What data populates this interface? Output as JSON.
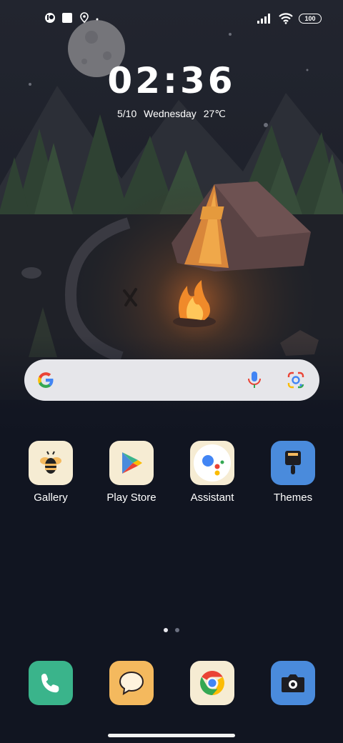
{
  "status_bar": {
    "left_icons": [
      "app-notification-icon",
      "square-notification-icon",
      "location-pin-icon",
      "more-dot-icon"
    ],
    "right_icons": [
      "signal-icon",
      "wifi-icon"
    ],
    "battery": "100"
  },
  "clock": {
    "time": "02:36",
    "date": "5/10",
    "weekday": "Wednesday",
    "temperature": "27℃"
  },
  "search": {
    "icons": [
      "google-logo-icon",
      "microphone-icon",
      "google-lens-icon"
    ]
  },
  "apps": [
    {
      "label": "Gallery",
      "icon": "bee-icon",
      "bg": "#f6ecd3"
    },
    {
      "label": "Play Store",
      "icon": "play-triangle-icon",
      "bg": "#f6ecd3"
    },
    {
      "label": "Assistant",
      "icon": "assistant-dots-icon",
      "bg": "#f6ecd3"
    },
    {
      "label": "Themes",
      "icon": "paint-brush-icon",
      "bg": "#4a8bdc"
    }
  ],
  "dock": [
    {
      "name": "phone",
      "icon": "phone-icon",
      "bg": "#3ab48b"
    },
    {
      "name": "messages",
      "icon": "chat-bubble-icon",
      "bg": "#f4b95e"
    },
    {
      "name": "chrome",
      "icon": "chrome-icon",
      "bg": "#f6ecd3"
    },
    {
      "name": "camera",
      "icon": "camera-icon",
      "bg": "#4a8bdc"
    }
  ],
  "pages": {
    "count": 2,
    "current": 1
  }
}
